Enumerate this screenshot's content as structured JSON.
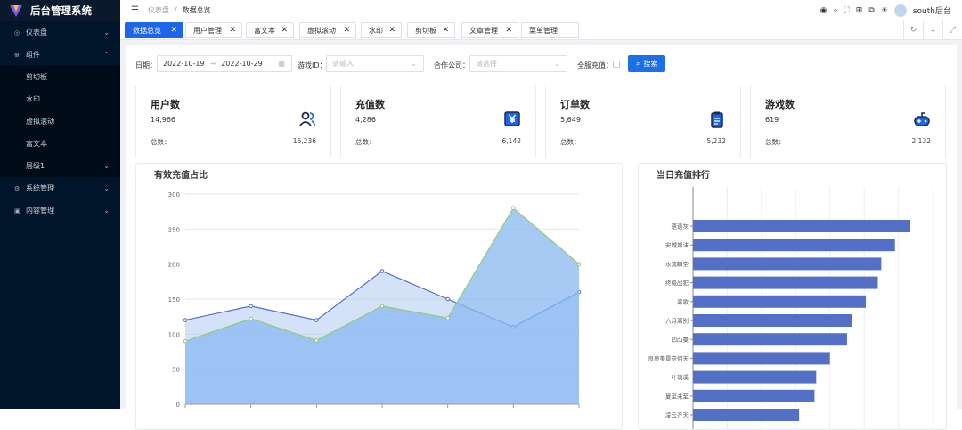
{
  "app": {
    "title": "后台管理系统"
  },
  "sidebar": {
    "items": [
      {
        "label": "仪表盘",
        "icon": "dashboard-icon"
      },
      {
        "label": "组件",
        "icon": "component-icon"
      },
      {
        "label": "剪切板"
      },
      {
        "label": "水印"
      },
      {
        "label": "虚拟滚动"
      },
      {
        "label": "富文本"
      },
      {
        "label": "层级1"
      },
      {
        "label": "系统管理",
        "icon": "gear-icon"
      },
      {
        "label": "内容管理",
        "icon": "content-icon"
      }
    ]
  },
  "header": {
    "breadcrumb": [
      "仪表盘",
      "/",
      "数据总览"
    ],
    "user": "south后台"
  },
  "tabs": [
    "数据总览",
    "用户管理",
    "富文本",
    "虚拟滚动",
    "水印",
    "剪切板",
    "文章管理",
    "菜单管理"
  ],
  "filters": {
    "date_label": "日期：",
    "date_start": "2022-10-19",
    "date_sep": "→",
    "date_end": "2022-10-29",
    "game_label": "游戏ID：",
    "game_placeholder": "请输入",
    "company_label": "合作公司：",
    "company_placeholder": "请选择",
    "recharge_label": "全服充值：",
    "search_label": "搜索"
  },
  "cards": [
    {
      "title": "用户数",
      "value": "14,966",
      "total_label": "总数：",
      "total": "16,236",
      "icon": "users-icon"
    },
    {
      "title": "充值数",
      "value": "4,286",
      "total_label": "总数：",
      "total": "6,142",
      "icon": "yen-icon"
    },
    {
      "title": "订单数",
      "value": "5,649",
      "total_label": "总数：",
      "total": "5,232",
      "icon": "clipboard-icon"
    },
    {
      "title": "游戏数",
      "value": "619",
      "total_label": "总数：",
      "total": "2,132",
      "icon": "gamepad-icon"
    }
  ],
  "colors": {
    "accent": "#1d66e6",
    "sidebar": "#001529",
    "area_blue": "#5470c6",
    "area_green": "#91cc75",
    "bar": "#5470c6"
  },
  "chart_data": [
    {
      "type": "area",
      "title": "有效充值占比",
      "ylim": [
        0,
        300
      ],
      "yticks": [
        0,
        50,
        100,
        150,
        200,
        250,
        300
      ],
      "grid": true,
      "series": [
        {
          "values": [
            120,
            140,
            120,
            190,
            150,
            110,
            160
          ],
          "color": "#5470c6"
        },
        {
          "values": [
            90,
            122,
            91,
            140,
            123,
            280,
            200
          ],
          "color": "#91cc75"
        }
      ]
    },
    {
      "type": "bar",
      "orientation": "horizontal",
      "title": "当日充值排行",
      "categories": [
        "凌云齐天",
        "夏至未至",
        "叶璃溪",
        "良辰美景奈何天",
        "凹凸曼",
        "六月离别",
        "离歌",
        "终极战犯",
        "水流瞬空",
        "安城如沫",
        "遗遗灰"
      ],
      "values": [
        62,
        71,
        72,
        80,
        90,
        93,
        101,
        108,
        110,
        118,
        127
      ],
      "grid": true
    }
  ]
}
